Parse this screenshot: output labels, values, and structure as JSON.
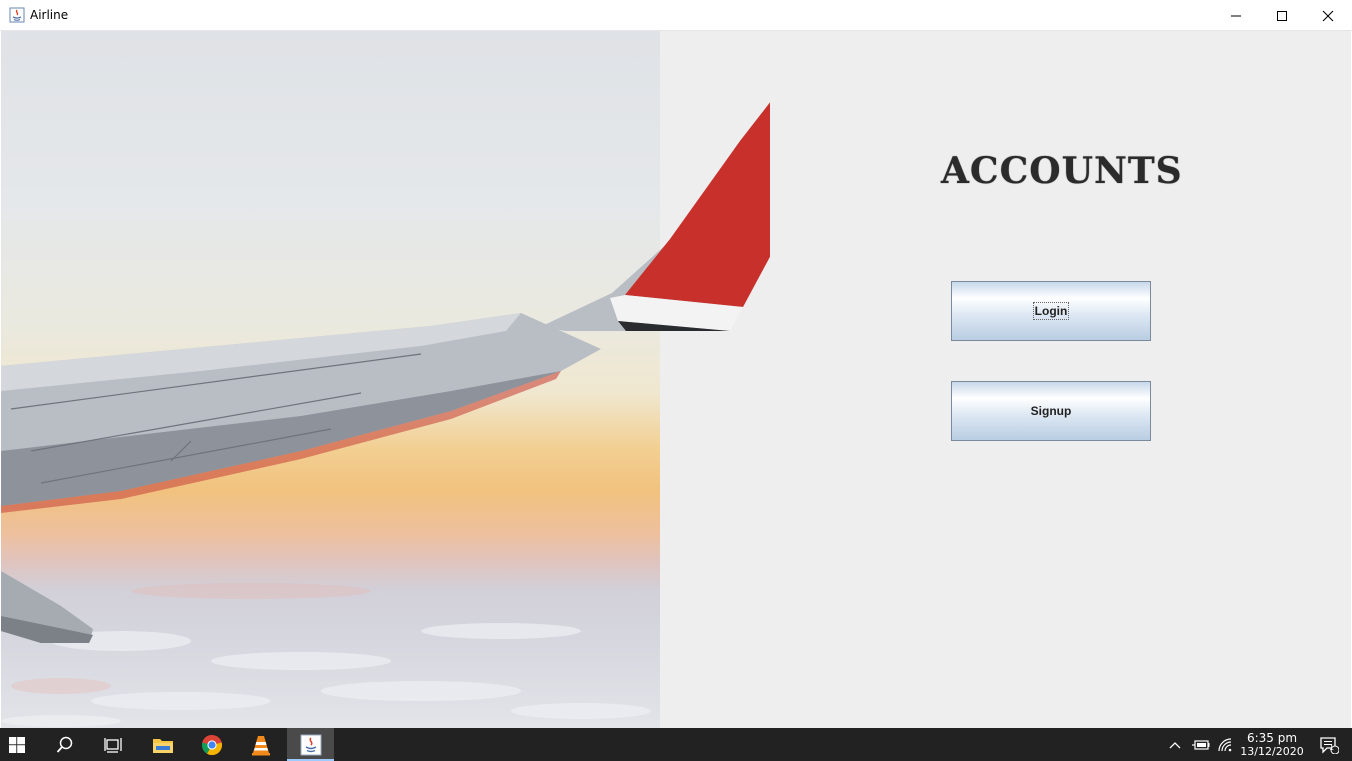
{
  "window": {
    "title": "Airline",
    "controls": {
      "minimize": "—",
      "maximize": "☐",
      "close": "✕"
    }
  },
  "content": {
    "heading": "ACCOUNTS",
    "buttons": {
      "login": "Login",
      "signup": "Signup"
    }
  },
  "taskbar": {
    "apps": [
      "windows-start",
      "search",
      "task-view",
      "file-explorer",
      "chrome",
      "vlc",
      "java"
    ],
    "clock": {
      "time": "6:35 pm",
      "date": "13/12/2020"
    },
    "notification_count": "1"
  },
  "colors": {
    "panel_bg": "#eeeeee",
    "wing_red": "#c8312b",
    "taskbar_bg": "#222222"
  }
}
